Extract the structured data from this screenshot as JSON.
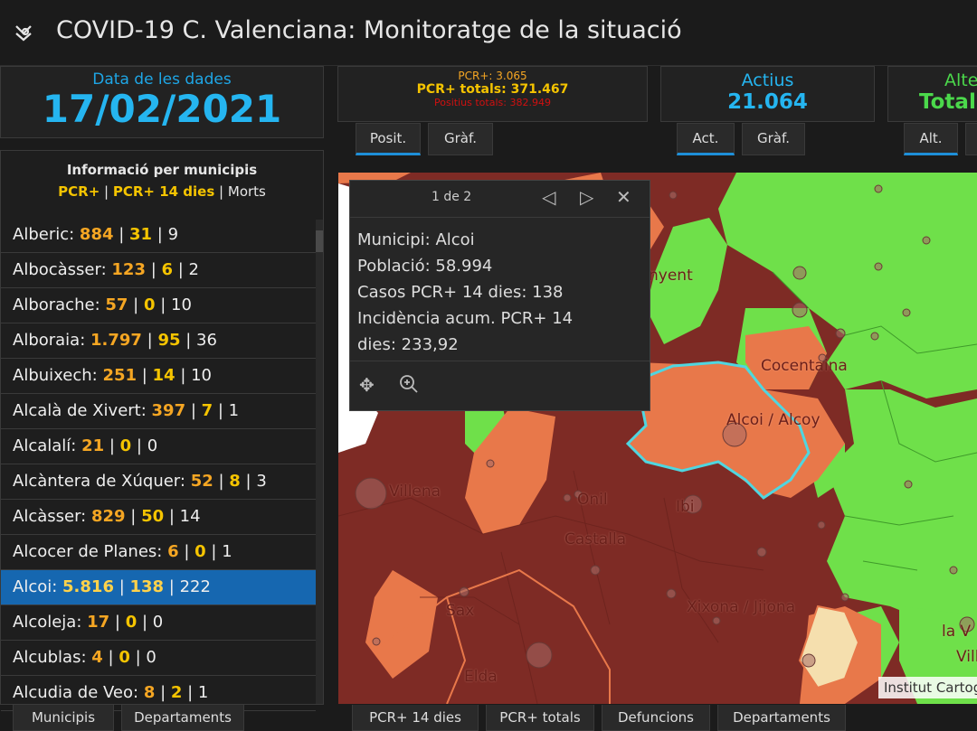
{
  "app": {
    "title": "COVID-19 C. Valenciana: Monitoratge de la situació",
    "logo_icon": "virus-icon"
  },
  "date_panel": {
    "label": "Data de les dades",
    "value": "17/02/2021"
  },
  "pcr_panel": {
    "line1": "PCR+: 3.065",
    "line2": "PCR+ totals: 371.467",
    "line3": "Positius totals: 382.949",
    "tabs": [
      "Posit.",
      "Gràf."
    ]
  },
  "active_panel": {
    "label": "Actius",
    "value": "21.064",
    "tabs": [
      "Act.",
      "Gràf."
    ]
  },
  "alt_panel": {
    "label": "Alte",
    "value": "Totals",
    "tabs": [
      "Alt."
    ]
  },
  "muni_panel": {
    "heading": "Informació per municipis",
    "legend_pcr": "PCR+",
    "legend_sep1": " | ",
    "legend_pcr14": "PCR+ 14 dies",
    "legend_sep2": " | ",
    "legend_deaths": "Morts",
    "rows": [
      {
        "name": "Alberic:",
        "pcr": "884",
        "pcr14": "31",
        "deaths": "9",
        "selected": false
      },
      {
        "name": "Albocàsser:",
        "pcr": "123",
        "pcr14": "6",
        "deaths": "2",
        "selected": false
      },
      {
        "name": "Alborache:",
        "pcr": "57",
        "pcr14": "0",
        "deaths": "10",
        "selected": false
      },
      {
        "name": "Alboraia:",
        "pcr": "1.797",
        "pcr14": "95",
        "deaths": "36",
        "selected": false
      },
      {
        "name": "Albuixech:",
        "pcr": "251",
        "pcr14": "14",
        "deaths": "10",
        "selected": false
      },
      {
        "name": "Alcalà de Xivert:",
        "pcr": "397",
        "pcr14": "7",
        "deaths": "1",
        "selected": false
      },
      {
        "name": "Alcalalí:",
        "pcr": "21",
        "pcr14": "0",
        "deaths": "0",
        "selected": false
      },
      {
        "name": "Alcàntera de Xúquer:",
        "pcr": "52",
        "pcr14": "8",
        "deaths": "3",
        "selected": false
      },
      {
        "name": "Alcàsser:",
        "pcr": "829",
        "pcr14": "50",
        "deaths": "14",
        "selected": false
      },
      {
        "name": "Alcocer de Planes:",
        "pcr": "6",
        "pcr14": "0",
        "deaths": "1",
        "selected": false
      },
      {
        "name": "Alcoi:",
        "pcr": "5.816",
        "pcr14": "138",
        "deaths": "222",
        "selected": true
      },
      {
        "name": "Alcoleja:",
        "pcr": "17",
        "pcr14": "0",
        "deaths": "0",
        "selected": false
      },
      {
        "name": "Alcublas:",
        "pcr": "4",
        "pcr14": "0",
        "deaths": "0",
        "selected": false
      },
      {
        "name": "Alcudia de Veo:",
        "pcr": "8",
        "pcr14": "2",
        "deaths": "1",
        "selected": false
      }
    ]
  },
  "left_tabs": [
    "Municipis",
    "Departaments"
  ],
  "map_tabs": [
    "PCR+ 14 dies",
    "PCR+ totals",
    "Defuncions",
    "Departaments"
  ],
  "popup": {
    "pager": "1 de 2",
    "lines": [
      "Municipi: Alcoi",
      "Població: 58.994",
      "Casos PCR+ 14 dies: 138",
      "Incidència acum. PCR+ 14",
      "dies: 233,92"
    ]
  },
  "map": {
    "labels": [
      "Villena",
      "Onil",
      "Castalla",
      "Ibi",
      "Sax",
      "Elda",
      "Xixona / Jijona",
      "Alcoi / Alcoy",
      "Cocentaina",
      "nyent",
      "la V",
      "Vill"
    ],
    "attribution": "Institut Cartogràfic Valencià",
    "colors": {
      "dark_red": "#7e2b25",
      "orange": "#e8784a",
      "green": "#6fe04a",
      "cream": "#f5dfae",
      "highlight": "#4fd6e0"
    }
  }
}
